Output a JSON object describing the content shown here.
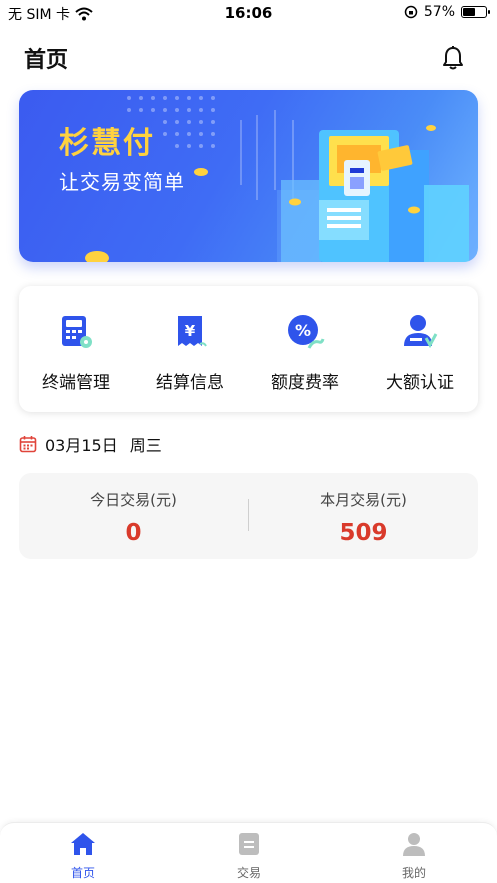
{
  "status_bar": {
    "carrier": "无 SIM 卡",
    "time": "16:06",
    "battery_percent": "57%",
    "battery_level": 0.57
  },
  "nav": {
    "title": "首页"
  },
  "banner": {
    "title": "杉慧付",
    "subtitle": "让交易变简单"
  },
  "quick_actions": [
    {
      "label": "终端管理",
      "icon": "terminal-icon"
    },
    {
      "label": "结算信息",
      "icon": "settlement-icon"
    },
    {
      "label": "额度费率",
      "icon": "rate-icon"
    },
    {
      "label": "大额认证",
      "icon": "verify-icon"
    }
  ],
  "date": {
    "day": "03月15日",
    "weekday": "周三"
  },
  "stats": {
    "today": {
      "label": "今日交易(元)",
      "value": "0"
    },
    "month": {
      "label": "本月交易(元)",
      "value": "509"
    }
  },
  "tabbar": {
    "items": [
      {
        "label": "首页",
        "icon": "home-icon",
        "active": true
      },
      {
        "label": "交易",
        "icon": "transaction-icon",
        "active": false
      },
      {
        "label": "我的",
        "icon": "profile-icon",
        "active": false
      }
    ]
  },
  "colors": {
    "accent": "#2f54eb",
    "value_red": "#d93a2b",
    "banner_title": "#ffd23f"
  }
}
